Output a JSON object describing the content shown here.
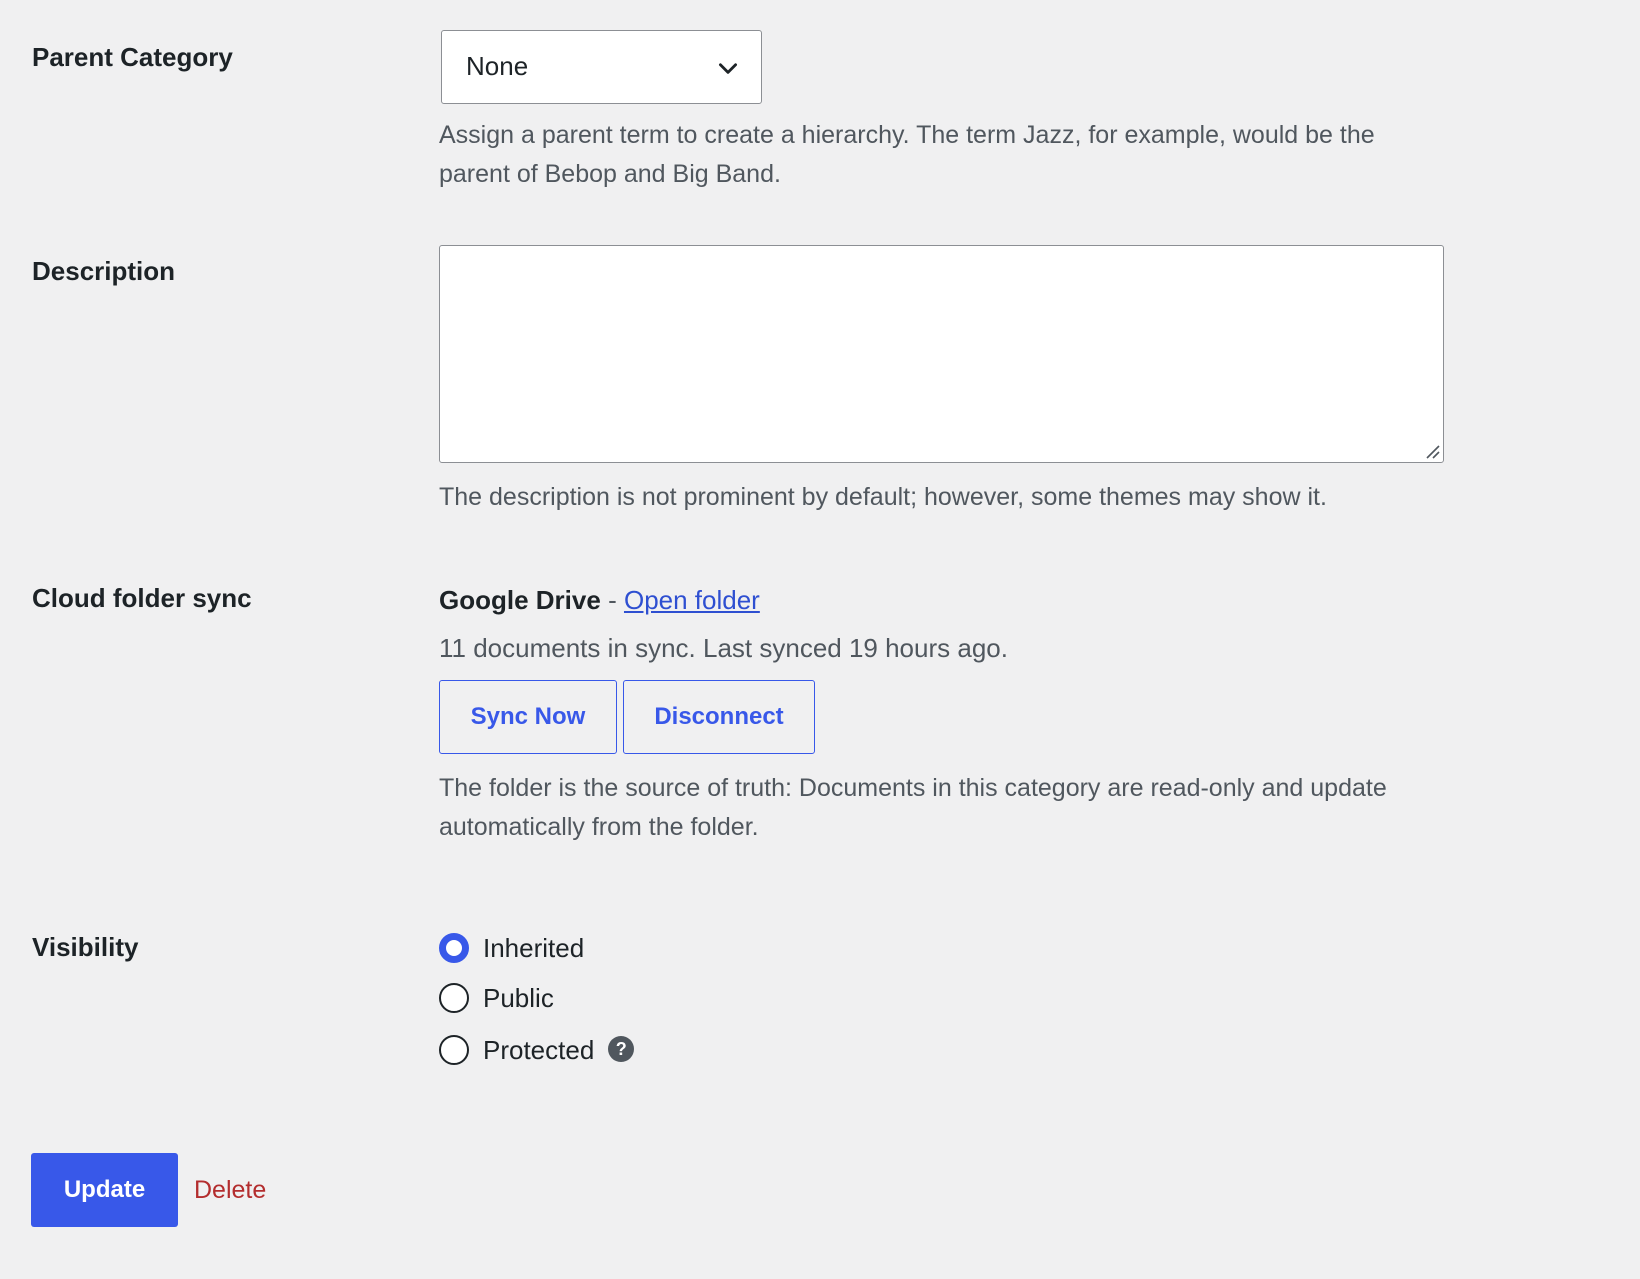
{
  "parent_category": {
    "label": "Parent Category",
    "selected": "None",
    "description": "Assign a parent term to create a hierarchy. The term Jazz, for example, would be the parent of Bebop and Big Band."
  },
  "description_field": {
    "label": "Description",
    "value": "",
    "help": "The description is not prominent by default; however, some themes may show it."
  },
  "cloud_sync": {
    "label": "Cloud folder sync",
    "provider": "Google Drive",
    "separator": "-",
    "open_folder_link": "Open folder",
    "status": "11 documents in sync. Last synced 19 hours ago.",
    "sync_now_label": "Sync Now",
    "disconnect_label": "Disconnect",
    "note": "The folder is the source of truth: Documents in this category are read-only and update automatically from the folder."
  },
  "visibility": {
    "label": "Visibility",
    "options": [
      {
        "label": "Inherited",
        "checked": true
      },
      {
        "label": "Public",
        "checked": false
      },
      {
        "label": "Protected",
        "checked": false
      }
    ],
    "help_glyph": "?"
  },
  "actions": {
    "update_label": "Update",
    "delete_label": "Delete"
  },
  "colors": {
    "accent": "#3858e9",
    "danger": "#b32d2e",
    "background": "#f0f0f1"
  }
}
